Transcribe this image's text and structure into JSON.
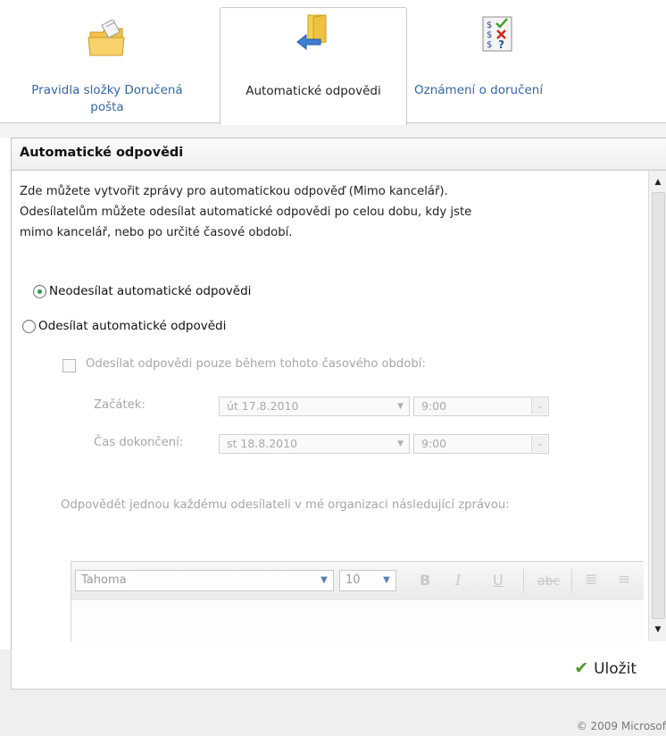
{
  "tabs": [
    {
      "label_line1": "Pravidla složky Doručená",
      "label_line2": "pošta",
      "icon": "folder-rules-icon"
    },
    {
      "label": "Automatické odpovědi",
      "icon": "auto-reply-icon",
      "active": true
    },
    {
      "label": "Oznámení o doručení",
      "icon": "delivery-report-icon"
    }
  ],
  "panel": {
    "title": "Automatické odpovědi",
    "intro_lines": [
      "Zde můžete vytvořit zprávy pro automatickou odpověď (Mimo kancelář).",
      "Odesílatelům můžete odesílat automatické odpovědi po celou dobu, kdy jste",
      "mimo kancelář, nebo po určité časové období."
    ],
    "radio_dont_send": "Neodesílat automatické odpovědi",
    "radio_send": "Odesílat automatické odpovědi",
    "selected_radio": "dont_send",
    "time_period_checkbox": "Odesílat odpovědi pouze během tohoto časového období:",
    "start_label": "Začátek:",
    "start_date": "út 17.8.2010",
    "start_time": "9:00",
    "end_label": "Čas dokončení:",
    "end_date": "st 18.8.2010",
    "end_time": "9:00",
    "reply_label": "Odpovědět jednou každému odesílateli v mé organizaci následující zprávou:",
    "font_name": "Tahoma",
    "font_size": "10",
    "bold": "B",
    "italic": "I",
    "underline": "U"
  },
  "footer": {
    "save_label": "Uložit",
    "copyright": "© 2009 Microsof"
  },
  "colors": {
    "link": "#3366a8",
    "save_check": "#4e9b28",
    "radio_selected": "#2f9e44"
  }
}
